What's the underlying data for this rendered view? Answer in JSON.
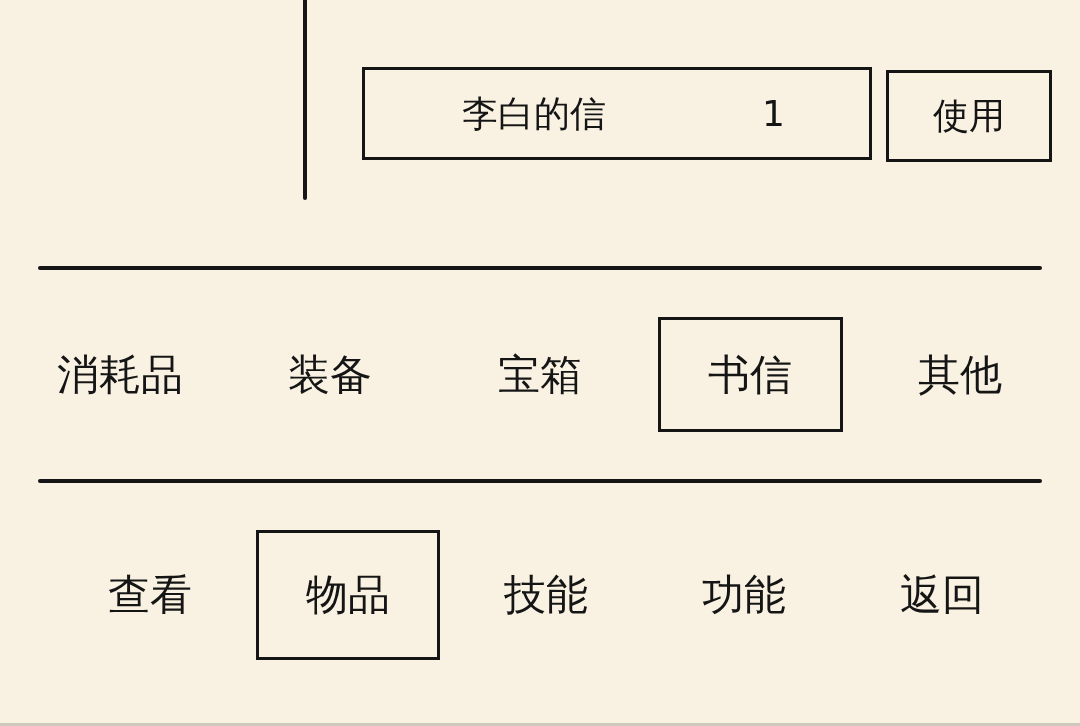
{
  "inventory": {
    "items": [
      {
        "name": "李白的信",
        "quantity": "1",
        "action": "使用"
      }
    ]
  },
  "categories": [
    {
      "label": "消耗品",
      "selected": false
    },
    {
      "label": "装备",
      "selected": false
    },
    {
      "label": "宝箱",
      "selected": false
    },
    {
      "label": "书信",
      "selected": true
    },
    {
      "label": "其他",
      "selected": false
    }
  ],
  "menu": [
    {
      "label": "查看",
      "selected": false
    },
    {
      "label": "物品",
      "selected": true
    },
    {
      "label": "技能",
      "selected": false
    },
    {
      "label": "功能",
      "selected": false
    },
    {
      "label": "返回",
      "selected": false
    }
  ]
}
